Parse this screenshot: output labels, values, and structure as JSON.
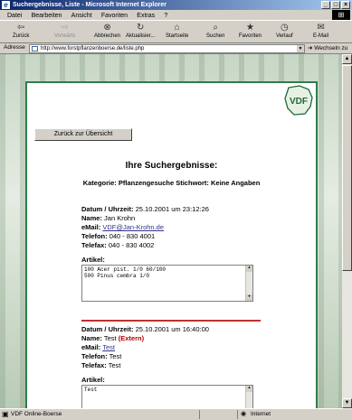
{
  "window": {
    "title": "Suchergebnisse, Liste - Microsoft Internet Explorer"
  },
  "menu": [
    "Datei",
    "Bearbeiten",
    "Ansicht",
    "Favoriten",
    "Extras",
    "?"
  ],
  "toolbar": {
    "back": "Zurück",
    "forward": "Vorwärts",
    "stop": "Abbrechen",
    "refresh": "Aktualisier...",
    "home": "Startseite",
    "search": "Suchen",
    "favorites": "Favoriten",
    "history": "Verlauf",
    "mail": "E-Mail"
  },
  "address": {
    "label": "Adresse",
    "url": "http://www.forstpflanzenboerse.de/liste.php",
    "go": "Wechseln zu"
  },
  "page": {
    "back_button": "Zurück zur Übersicht",
    "heading": "Ihre Suchergebnisse:",
    "subheading": "Kategorie: Pflanzengesuche   Stichwort: Keine Angaben",
    "logo": "VDF",
    "entries": [
      {
        "datum_label": "Datum / Uhrzeit:",
        "datum": "25.10.2001 um 23:12:26",
        "name_label": "Name:",
        "name": "Jan Krohn",
        "extern": "",
        "email_label": "eMail:",
        "email": "VDF@Jan-Krohn.de",
        "telefon_label": "Telefon:",
        "telefon": "040 - 830 4001",
        "telefax_label": "Telefax:",
        "telefax": "040 - 830 4002",
        "artikel_label": "Artikel:",
        "artikel_line1": "100 Acer pist. 1/0 60/100",
        "artikel_line2": "500 Pinus cembra 1/0"
      },
      {
        "datum_label": "Datum / Uhrzeit:",
        "datum": "25.10.2001 um 16:40:00",
        "name_label": "Name:",
        "name": "Test",
        "extern": "(Extern)",
        "email_label": "eMail:",
        "email": "Test",
        "telefon_label": "Telefon:",
        "telefon": "Test",
        "telefax_label": "Telefax:",
        "telefax": "Test",
        "artikel_label": "Artikel:",
        "artikel_line1": "Test",
        "artikel_line2": ""
      }
    ]
  },
  "status": {
    "text": "VDF Online-Boerse",
    "zone": "Internet"
  }
}
